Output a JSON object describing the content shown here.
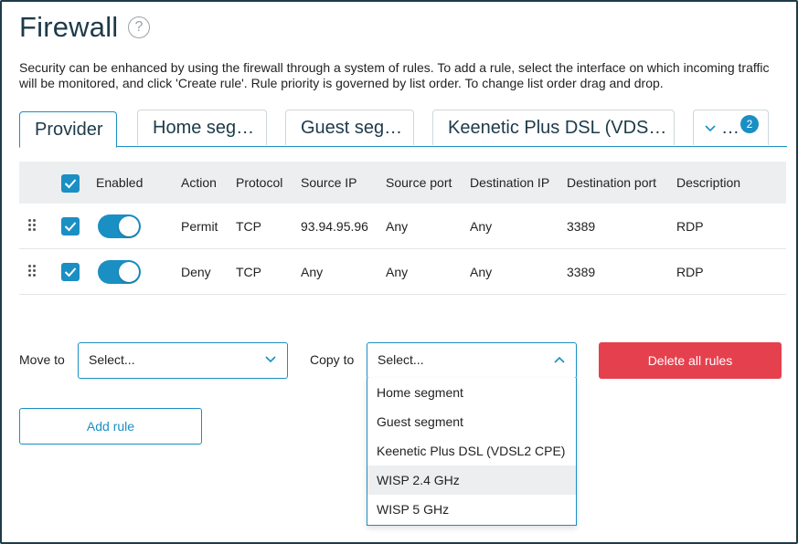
{
  "page": {
    "title": "Firewall",
    "help_icon": "?",
    "description": "Security can be enhanced by using the firewall through a system of rules. To add a rule, select the interface on which incoming traffic will be monitored, and click 'Create rule'. Rule priority is governed by list order. To change list order drag and drop."
  },
  "tabs": {
    "items": [
      {
        "label": "Provider",
        "active": true
      },
      {
        "label": "Home seg…",
        "active": false
      },
      {
        "label": "Guest seg…",
        "active": false
      },
      {
        "label": "Keenetic Plus DSL (VDS…",
        "active": false
      }
    ],
    "more_label": "…",
    "more_badge": "2"
  },
  "table": {
    "headers": [
      "Enabled",
      "Action",
      "Protocol",
      "Source IP",
      "Source port",
      "Destination IP",
      "Destination port",
      "Description"
    ],
    "rows": [
      {
        "checked": true,
        "enabled": true,
        "action": "Permit",
        "protocol": "TCP",
        "source_ip": "93.94.95.96",
        "source_port": "Any",
        "destination_ip": "Any",
        "destination_port": "3389",
        "description": "RDP"
      },
      {
        "checked": true,
        "enabled": true,
        "action": "Deny",
        "protocol": "TCP",
        "source_ip": "Any",
        "source_port": "Any",
        "destination_ip": "Any",
        "destination_port": "3389",
        "description": "RDP"
      }
    ]
  },
  "controls": {
    "move_to_label": "Move to",
    "move_to_value": "Select...",
    "copy_to_label": "Copy to",
    "copy_to_value": "Select...",
    "delete_all_label": "Delete all rules",
    "add_rule_label": "Add rule"
  },
  "dropdown": {
    "options": [
      "Home segment",
      "Guest segment",
      "Keenetic Plus DSL (VDSL2 CPE)",
      "WISP 2.4 GHz",
      "WISP 5 GHz"
    ],
    "highlighted": "WISP 2.4 GHz"
  },
  "colors": {
    "accent": "#1a8fc4",
    "danger": "#e5404e",
    "header_bg": "#eceeef",
    "title": "#1d3a4a"
  }
}
